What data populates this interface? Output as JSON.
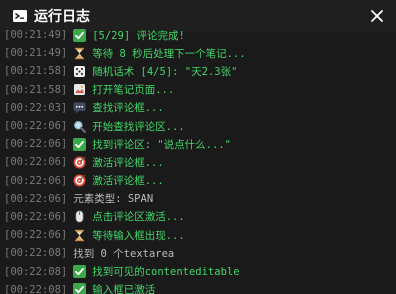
{
  "header": {
    "title": "运行日志",
    "logo_icon": "terminal-icon",
    "close_icon": "close-icon"
  },
  "log": [
    {
      "time": "[00:21:49]",
      "icon": "check-icon",
      "text": "[5/29] 评论完成!",
      "color": "green"
    },
    {
      "time": "[00:21:49]",
      "icon": "hourglass-icon",
      "text": "等待 8 秒后处理下一个笔记...",
      "color": "green"
    },
    {
      "time": "[00:21:58]",
      "icon": "dice-icon",
      "text": "随机话术 [4/5]: \"天2.3张\"",
      "color": "green"
    },
    {
      "time": "[00:21:58]",
      "icon": "image-icon",
      "text": "打开笔记页面...",
      "color": "green"
    },
    {
      "time": "[00:22:03]",
      "icon": "chat-icon",
      "text": "查找评论框...",
      "color": "green"
    },
    {
      "time": "[00:22:06]",
      "icon": "magnifier-icon",
      "text": "开始查找评论区...",
      "color": "green"
    },
    {
      "time": "[00:22:06]",
      "icon": "check-icon",
      "text": "找到评论区: \"说点什么...\"",
      "color": "green"
    },
    {
      "time": "[00:22:06]",
      "icon": "target-icon",
      "text": "激活评论框...",
      "color": "green"
    },
    {
      "time": "[00:22:06]",
      "icon": "target-icon",
      "text": "激活评论框...",
      "color": "green"
    },
    {
      "time": "[00:22:06]",
      "icon": "",
      "text": "元素类型: SPAN",
      "color": "gray"
    },
    {
      "time": "[00:22:06]",
      "icon": "mouse-icon",
      "text": "点击评论区激活...",
      "color": "green"
    },
    {
      "time": "[00:22:06]",
      "icon": "hourglass-icon",
      "text": "等待输入框出现...",
      "color": "green"
    },
    {
      "time": "[00:22:08]",
      "icon": "",
      "text": "找到 0 个textarea",
      "color": "gray"
    },
    {
      "time": "[00:22:08]",
      "icon": "check-icon",
      "text": "找到可见的contenteditable",
      "color": "green"
    },
    {
      "time": "[00:22:08]",
      "icon": "check-icon",
      "text": "输入框已激活",
      "color": "green"
    }
  ]
}
